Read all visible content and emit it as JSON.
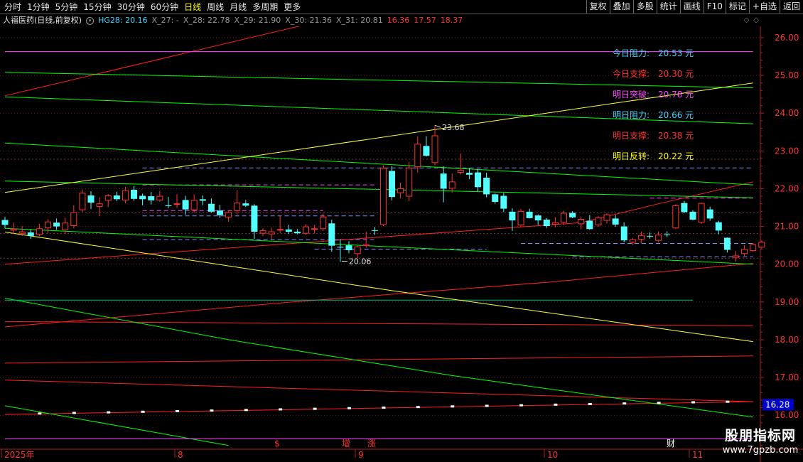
{
  "toolbar": {
    "periods": [
      "分时",
      "1分钟",
      "5分钟",
      "15分钟",
      "30分钟",
      "60分钟",
      "日线",
      "周线",
      "月线",
      "多周期",
      "更多"
    ],
    "active_period": "日线",
    "right_buttons": [
      "复权",
      "叠加",
      "多股",
      "统计",
      "画线",
      "F10",
      "标记",
      "+自选",
      "返回"
    ]
  },
  "title": {
    "stock": "人福医药(日线,前复权)",
    "indicators": [
      {
        "label": "HG28: 20.16",
        "color": "#3fd3ff"
      },
      {
        "label": "X_27: -",
        "color": "#9a9a9a"
      },
      {
        "label": "X_28: 22.78",
        "color": "#9a9a9a"
      },
      {
        "label": "X_29: 21.90",
        "color": "#9a9a9a"
      },
      {
        "label": "X_30: 21.36",
        "color": "#9a9a9a"
      },
      {
        "label": "X_31: 20.81",
        "color": "#9a9a9a"
      },
      {
        "label": "16.36",
        "color": "#ff3333"
      },
      {
        "label": "17.57",
        "color": "#ff3333"
      },
      {
        "label": "18.37",
        "color": "#ff3333"
      }
    ]
  },
  "annotations": [
    {
      "label": "今日阻力:",
      "value": "20.53 元",
      "color": "#3fd3ff"
    },
    {
      "label": "今日支撑:",
      "value": "20.30 元",
      "color": "#ff3333"
    },
    {
      "label": "明日突破:",
      "value": "20.78 元",
      "color": "#ff44ff"
    },
    {
      "label": "明日阻力:",
      "value": "20.66 元",
      "color": "#3fd3ff"
    },
    {
      "label": "明日支撑:",
      "value": "20.38 元",
      "color": "#ff3333"
    },
    {
      "label": "明日反转:",
      "value": "20.22 元",
      "color": "#ffff00"
    }
  ],
  "price_axis": {
    "labels": [
      "26.00",
      "25.00",
      "24.00",
      "23.00",
      "22.00",
      "21.00",
      "20.00",
      "19.00",
      "18.00",
      "17.00",
      "16.00"
    ],
    "current_price": "16.28"
  },
  "time_axis": [
    "2025年",
    "8",
    "9",
    "10",
    "11"
  ],
  "markers": [
    {
      "text": "$",
      "color": "#ff3333"
    },
    {
      "text": "增",
      "color": "#ff3333"
    },
    {
      "text": "涨",
      "color": "#ff3333"
    },
    {
      "text": "财",
      "color": "#ffffff"
    }
  ],
  "high_label": "23.68",
  "low_label": "20.06",
  "watermark": {
    "line1": "股朋指标网",
    "line2": "www.7gpzb.com"
  },
  "colors": {
    "up": "#ff3333",
    "down": "#54ffff",
    "bg": "#000000"
  },
  "chart_data": {
    "type": "candlestick",
    "y_range": [
      15.1,
      26.3
    ],
    "candles": [
      {
        "o": 21.17,
        "h": 21.25,
        "l": 20.95,
        "c": 21.04
      },
      {
        "o": 20.9,
        "h": 21.1,
        "l": 20.8,
        "c": 20.93
      },
      {
        "o": 20.82,
        "h": 21.01,
        "l": 20.75,
        "c": 20.86
      },
      {
        "o": 20.84,
        "h": 20.93,
        "l": 20.67,
        "c": 20.75
      },
      {
        "o": 20.79,
        "h": 21.07,
        "l": 20.74,
        "c": 20.94
      },
      {
        "o": 20.96,
        "h": 21.19,
        "l": 20.83,
        "c": 21.12
      },
      {
        "o": 21.1,
        "h": 21.21,
        "l": 20.91,
        "c": 21.0
      },
      {
        "o": 20.91,
        "h": 21.23,
        "l": 20.8,
        "c": 21.09
      },
      {
        "o": 21.02,
        "h": 21.56,
        "l": 20.95,
        "c": 21.37
      },
      {
        "o": 21.44,
        "h": 21.98,
        "l": 21.39,
        "c": 21.88
      },
      {
        "o": 21.82,
        "h": 21.93,
        "l": 21.46,
        "c": 21.63
      },
      {
        "o": 21.53,
        "h": 21.77,
        "l": 21.27,
        "c": 21.6
      },
      {
        "o": 21.69,
        "h": 21.86,
        "l": 21.51,
        "c": 21.81
      },
      {
        "o": 21.82,
        "h": 21.92,
        "l": 21.67,
        "c": 21.72
      },
      {
        "o": 21.7,
        "h": 22.05,
        "l": 21.61,
        "c": 21.95
      },
      {
        "o": 21.97,
        "h": 22.07,
        "l": 21.68,
        "c": 21.73
      },
      {
        "o": 21.81,
        "h": 21.87,
        "l": 21.56,
        "c": 21.72
      },
      {
        "o": 21.8,
        "h": 21.91,
        "l": 21.58,
        "c": 21.69
      },
      {
        "o": 21.7,
        "h": 21.94,
        "l": 21.66,
        "c": 21.8
      },
      {
        "o": 21.56,
        "h": 21.78,
        "l": 21.48,
        "c": 21.54
      },
      {
        "o": 21.6,
        "h": 21.85,
        "l": 21.49,
        "c": 21.6
      },
      {
        "o": 21.7,
        "h": 21.81,
        "l": 21.31,
        "c": 21.45
      },
      {
        "o": 21.44,
        "h": 21.85,
        "l": 21.37,
        "c": 21.69
      },
      {
        "o": 21.72,
        "h": 21.82,
        "l": 21.56,
        "c": 21.68
      },
      {
        "o": 21.6,
        "h": 21.74,
        "l": 21.36,
        "c": 21.39
      },
      {
        "o": 21.42,
        "h": 21.57,
        "l": 21.23,
        "c": 21.3
      },
      {
        "o": 21.25,
        "h": 21.42,
        "l": 21.12,
        "c": 21.37
      },
      {
        "o": 21.42,
        "h": 21.96,
        "l": 21.32,
        "c": 21.62
      },
      {
        "o": 21.61,
        "h": 21.7,
        "l": 21.52,
        "c": 21.55
      },
      {
        "o": 21.55,
        "h": 21.59,
        "l": 20.67,
        "c": 20.86
      },
      {
        "o": 20.82,
        "h": 20.95,
        "l": 20.74,
        "c": 20.89
      },
      {
        "o": 20.8,
        "h": 20.97,
        "l": 20.66,
        "c": 20.86
      },
      {
        "o": 20.92,
        "h": 21.29,
        "l": 20.82,
        "c": 20.92
      },
      {
        "o": 20.92,
        "h": 21.04,
        "l": 20.8,
        "c": 20.86
      },
      {
        "o": 20.86,
        "h": 20.93,
        "l": 20.79,
        "c": 20.82
      },
      {
        "o": 20.82,
        "h": 21.06,
        "l": 20.77,
        "c": 20.99
      },
      {
        "o": 20.93,
        "h": 21.04,
        "l": 20.81,
        "c": 20.94
      },
      {
        "o": 20.94,
        "h": 21.34,
        "l": 20.88,
        "c": 21.25
      },
      {
        "o": 21.08,
        "h": 21.18,
        "l": 20.33,
        "c": 20.49
      },
      {
        "o": 20.46,
        "h": 20.67,
        "l": 20.06,
        "c": 20.44
      },
      {
        "o": 20.5,
        "h": 20.61,
        "l": 20.29,
        "c": 20.37
      },
      {
        "o": 20.28,
        "h": 20.49,
        "l": 20.16,
        "c": 20.46
      },
      {
        "o": 20.49,
        "h": 20.86,
        "l": 20.44,
        "c": 20.52
      },
      {
        "o": 20.9,
        "h": 20.99,
        "l": 20.77,
        "c": 20.89
      },
      {
        "o": 21.05,
        "h": 22.62,
        "l": 21.01,
        "c": 22.54
      },
      {
        "o": 22.47,
        "h": 22.59,
        "l": 21.69,
        "c": 21.78
      },
      {
        "o": 21.89,
        "h": 22.16,
        "l": 21.74,
        "c": 22.0
      },
      {
        "o": 21.8,
        "h": 22.71,
        "l": 21.67,
        "c": 22.55
      },
      {
        "o": 22.58,
        "h": 23.39,
        "l": 22.43,
        "c": 23.18
      },
      {
        "o": 23.13,
        "h": 23.39,
        "l": 22.85,
        "c": 22.87
      },
      {
        "o": 22.69,
        "h": 23.68,
        "l": 22.62,
        "c": 23.4
      },
      {
        "o": 22.4,
        "h": 22.59,
        "l": 21.64,
        "c": 22.0
      },
      {
        "o": 22.01,
        "h": 22.4,
        "l": 21.89,
        "c": 22.18
      },
      {
        "o": 22.43,
        "h": 22.93,
        "l": 22.37,
        "c": 22.49
      },
      {
        "o": 22.42,
        "h": 22.55,
        "l": 22.25,
        "c": 22.37
      },
      {
        "o": 22.43,
        "h": 22.52,
        "l": 21.93,
        "c": 22.04
      },
      {
        "o": 22.29,
        "h": 22.42,
        "l": 21.77,
        "c": 21.85
      },
      {
        "o": 21.85,
        "h": 21.87,
        "l": 21.6,
        "c": 21.65
      },
      {
        "o": 21.81,
        "h": 21.89,
        "l": 21.38,
        "c": 21.47
      },
      {
        "o": 21.39,
        "h": 21.48,
        "l": 20.88,
        "c": 21.16
      },
      {
        "o": 21.04,
        "h": 21.46,
        "l": 21.0,
        "c": 21.4
      },
      {
        "o": 21.39,
        "h": 21.47,
        "l": 21.21,
        "c": 21.22
      },
      {
        "o": 21.29,
        "h": 21.32,
        "l": 21.04,
        "c": 21.16
      },
      {
        "o": 21.18,
        "h": 21.22,
        "l": 20.96,
        "c": 21.01
      },
      {
        "o": 21.06,
        "h": 21.25,
        "l": 20.97,
        "c": 21.1
      },
      {
        "o": 21.11,
        "h": 21.41,
        "l": 21.04,
        "c": 21.35
      },
      {
        "o": 21.36,
        "h": 21.4,
        "l": 21.22,
        "c": 21.24
      },
      {
        "o": 21.07,
        "h": 21.24,
        "l": 20.92,
        "c": 21.19
      },
      {
        "o": 21.15,
        "h": 21.3,
        "l": 20.91,
        "c": 20.93
      },
      {
        "o": 21.04,
        "h": 21.28,
        "l": 20.99,
        "c": 21.23
      },
      {
        "o": 21.16,
        "h": 21.35,
        "l": 21.08,
        "c": 21.31
      },
      {
        "o": 21.21,
        "h": 21.3,
        "l": 20.99,
        "c": 21.05
      },
      {
        "o": 21.0,
        "h": 21.11,
        "l": 20.58,
        "c": 20.63
      },
      {
        "o": 20.58,
        "h": 20.7,
        "l": 20.51,
        "c": 20.65
      },
      {
        "o": 20.66,
        "h": 20.86,
        "l": 20.55,
        "c": 20.76
      },
      {
        "o": 20.75,
        "h": 20.84,
        "l": 20.68,
        "c": 20.74
      },
      {
        "o": 20.63,
        "h": 20.87,
        "l": 20.58,
        "c": 20.77
      },
      {
        "o": 20.79,
        "h": 20.87,
        "l": 20.72,
        "c": 20.78
      },
      {
        "o": 20.96,
        "h": 21.59,
        "l": 20.93,
        "c": 21.55
      },
      {
        "o": 21.62,
        "h": 21.68,
        "l": 21.35,
        "c": 21.38
      },
      {
        "o": 21.39,
        "h": 21.43,
        "l": 21.16,
        "c": 21.18
      },
      {
        "o": 21.11,
        "h": 21.63,
        "l": 21.07,
        "c": 21.61
      },
      {
        "o": 21.45,
        "h": 21.52,
        "l": 21.15,
        "c": 21.21
      },
      {
        "o": 21.11,
        "h": 21.15,
        "l": 20.79,
        "c": 20.89
      },
      {
        "o": 20.7,
        "h": 20.71,
        "l": 20.31,
        "c": 20.38
      },
      {
        "o": 20.18,
        "h": 20.35,
        "l": 20.06,
        "c": 20.22
      },
      {
        "o": 20.28,
        "h": 20.5,
        "l": 20.22,
        "c": 20.39
      },
      {
        "o": 20.36,
        "h": 20.56,
        "l": 20.33,
        "c": 20.52
      },
      {
        "o": 20.45,
        "h": 20.63,
        "l": 20.42,
        "c": 20.58
      }
    ],
    "lines": [
      {
        "color": "#ff2020",
        "p": [
          [
            0,
            24.46
          ],
          [
            44,
            26.83
          ]
        ]
      },
      {
        "color": "#ff2020",
        "p": [
          [
            0,
            20.0
          ],
          [
            67,
            21.1
          ],
          [
            76,
            21.6
          ],
          [
            87,
            22.18
          ]
        ]
      },
      {
        "color": "#ff2020",
        "p": [
          [
            0,
            18.48
          ],
          [
            87,
            18.37
          ]
        ]
      },
      {
        "color": "#ff2020",
        "p": [
          [
            0,
            17.38
          ],
          [
            87,
            17.57
          ]
        ]
      },
      {
        "color": "#ff2020",
        "p": [
          [
            0,
            16.93
          ],
          [
            87,
            16.36
          ]
        ]
      },
      {
        "color": "#ff2020",
        "p": [
          [
            0,
            16.02
          ],
          [
            87,
            16.36
          ]
        ]
      },
      {
        "color": "#ff2020",
        "p": [
          [
            0,
            18.34
          ],
          [
            33,
            18.99
          ],
          [
            63,
            19.52
          ],
          [
            87,
            20.02
          ]
        ]
      },
      {
        "color": "#00ff00",
        "p": [
          [
            0,
            25.08
          ],
          [
            87,
            24.67
          ]
        ]
      },
      {
        "color": "#00ff00",
        "p": [
          [
            0,
            24.43
          ],
          [
            87,
            23.72
          ]
        ]
      },
      {
        "color": "#00ff00",
        "p": [
          [
            0,
            23.21
          ],
          [
            87,
            22.1
          ]
        ]
      },
      {
        "color": "#00ff00",
        "p": [
          [
            0,
            22.2
          ],
          [
            87,
            21.76
          ]
        ]
      },
      {
        "color": "#00ff00",
        "p": [
          [
            0,
            20.95
          ],
          [
            87,
            20.0
          ]
        ]
      },
      {
        "color": "#00ff00",
        "p": [
          [
            0,
            19.1
          ],
          [
            26,
            18.0
          ],
          [
            52,
            17.05
          ],
          [
            87,
            15.95
          ]
        ]
      },
      {
        "color": "#00ff00",
        "p": [
          [
            0,
            16.25
          ],
          [
            26,
            15.2
          ]
        ]
      },
      {
        "color": "#00c080",
        "p": [
          [
            0,
            19.05
          ],
          [
            80,
            19.05
          ]
        ]
      },
      {
        "color": "#ffff40",
        "p": [
          [
            0,
            21.9
          ],
          [
            87,
            24.8
          ]
        ]
      },
      {
        "color": "#ffff40",
        "p": [
          [
            0,
            20.85
          ],
          [
            45,
            19.3
          ],
          [
            87,
            17.95
          ]
        ]
      },
      {
        "color": "#ff44ff",
        "p": [
          [
            0,
            25.63
          ],
          [
            87,
            25.63
          ]
        ]
      },
      {
        "color": "#ff44ff",
        "p": [
          [
            0,
            15.38
          ],
          [
            87,
            15.38
          ]
        ]
      }
    ],
    "hlines": [
      {
        "y": 22.55,
        "from": 16,
        "to": 87,
        "color": "#8888ff",
        "dash": "6,4"
      },
      {
        "y": 22.1,
        "from": 16,
        "to": 43,
        "color": "#ff44ff",
        "dash": "6,4"
      },
      {
        "y": 21.42,
        "from": 16,
        "to": 37,
        "color": "#ff44ff",
        "dash": "6,4"
      },
      {
        "y": 21.28,
        "from": 16,
        "to": 43,
        "color": "#8888ff",
        "dash": "6,4"
      },
      {
        "y": 20.65,
        "from": 16,
        "to": 43,
        "color": "#8888ff",
        "dash": "6,4"
      },
      {
        "y": 20.4,
        "from": 36,
        "to": 56,
        "color": "#8888ff",
        "dash": "6,4"
      },
      {
        "y": 21.75,
        "from": 75,
        "to": 87,
        "color": "#ff44ff",
        "dash": "6,4"
      },
      {
        "y": 20.55,
        "from": 60,
        "to": 87,
        "color": "#8888ff",
        "dash": "6,4"
      },
      {
        "y": 20.2,
        "from": 66,
        "to": 87,
        "color": "#8888ff",
        "dash": "6,4"
      }
    ],
    "grid": [
      26.0,
      25.0,
      24.0,
      23.0,
      22.0,
      21.0,
      20.0,
      19.0,
      18.0,
      17.0,
      16.0
    ],
    "grid_fine": [
      22.78,
      21.36,
      20.81,
      20.16
    ]
  }
}
